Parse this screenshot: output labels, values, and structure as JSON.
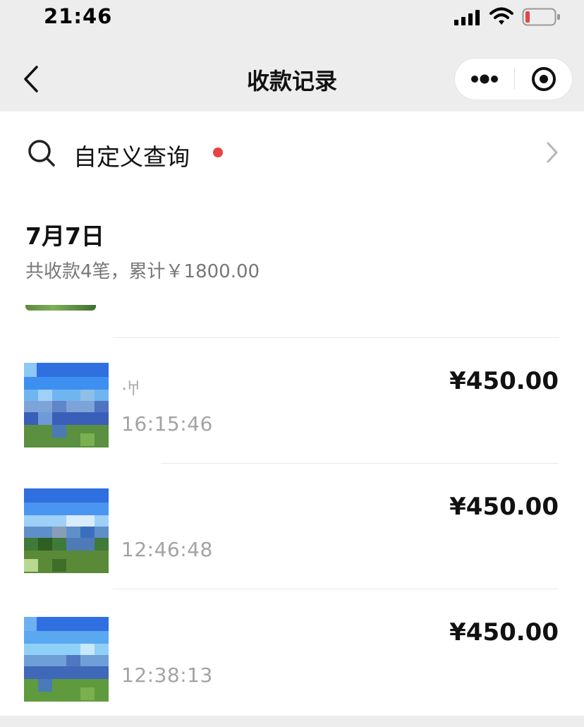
{
  "status_bar": {
    "time": "21:46",
    "icons": [
      "signal-icon",
      "wifi-icon",
      "battery-icon"
    ],
    "battery_color": "#e84343"
  },
  "nav": {
    "title": "收款记录",
    "back_icon": "chevron-left-icon",
    "more_icon": "more-dots-icon",
    "close_icon": "target-close-icon"
  },
  "search": {
    "label": "自定义查询",
    "icon": "search-icon",
    "dot_color": "#e84343"
  },
  "day": {
    "date": "7月7日",
    "summary": "共收款4笔，累计￥1800.00"
  },
  "records": [
    {
      "name": "·𐀀",
      "time": "16:15:46",
      "amount": "¥450.00"
    },
    {
      "name": "",
      "time": "12:46:48",
      "amount": "¥450.00"
    },
    {
      "name": "",
      "time": "12:38:13",
      "amount": "¥450.00"
    }
  ],
  "colors": {
    "background": "#ffffff",
    "header_bg": "#ededed",
    "secondary_text": "#a3a3a3"
  }
}
